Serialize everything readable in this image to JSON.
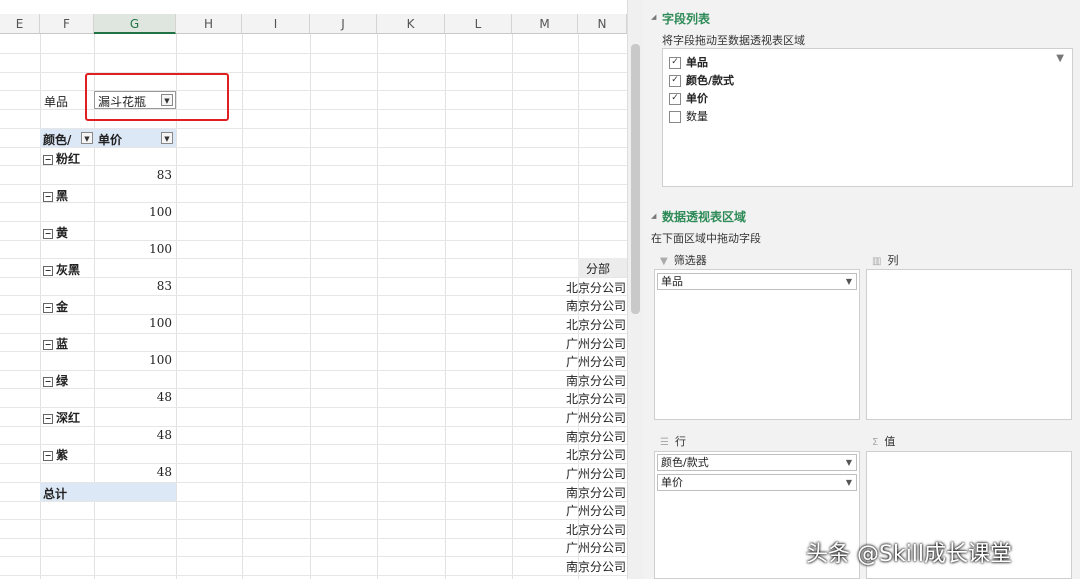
{
  "sheet": {
    "columns": [
      "E",
      "F",
      "G",
      "H",
      "I",
      "J",
      "K",
      "L",
      "M",
      "N"
    ],
    "selected_column": "G",
    "filter": {
      "label": "单品",
      "value": "漏斗花瓶"
    },
    "pivot_headers": {
      "color": "颜色/",
      "price": "单价"
    },
    "groups": [
      {
        "name": "粉红",
        "value": "83"
      },
      {
        "name": "黑",
        "value": "100"
      },
      {
        "name": "黄",
        "value": "100"
      },
      {
        "name": "灰黑",
        "value": "83"
      },
      {
        "name": "金",
        "value": "100"
      },
      {
        "name": "蓝",
        "value": "100"
      },
      {
        "name": "绿",
        "value": "48"
      },
      {
        "name": "深红",
        "value": "48"
      },
      {
        "name": "紫",
        "value": "48"
      }
    ],
    "total_label": "总计",
    "branch_header": "分部",
    "branches": [
      "北京分公司",
      "南京分公司",
      "北京分公司",
      "广州分公司",
      "广州分公司",
      "南京分公司",
      "北京分公司",
      "广州分公司",
      "南京分公司",
      "北京分公司",
      "广州分公司",
      "南京分公司",
      "广州分公司",
      "北京分公司",
      "广州分公司",
      "南京分公司"
    ]
  },
  "panel": {
    "field_list_title": "字段列表",
    "field_list_hint": "将字段拖动至数据透视表区域",
    "fields": [
      {
        "label": "单品",
        "checked": true
      },
      {
        "label": "颜色/款式",
        "checked": true
      },
      {
        "label": "单价",
        "checked": true
      },
      {
        "label": "数量",
        "checked": false
      }
    ],
    "areas_title": "数据透视表区域",
    "areas_hint": "在下面区域中拖动字段",
    "filters_label": "筛选器",
    "columns_label": "列",
    "rows_label": "行",
    "values_label": "值",
    "filter_items": [
      "单品"
    ],
    "row_items": [
      "颜色/款式",
      "单价"
    ]
  },
  "watermark": "头条 @Skill成长课堂"
}
